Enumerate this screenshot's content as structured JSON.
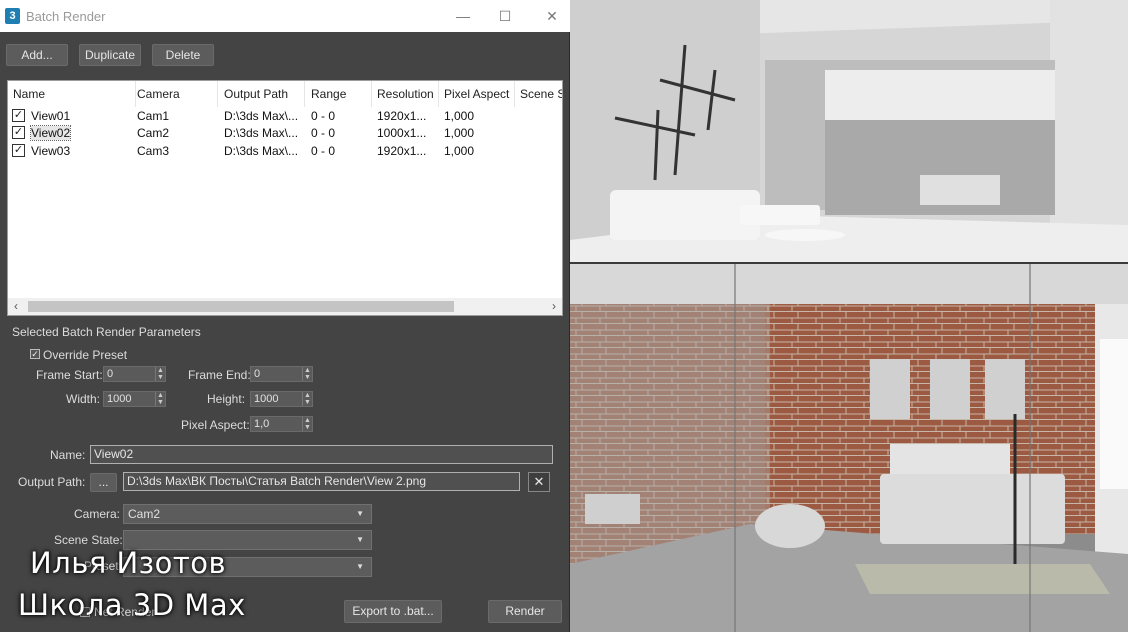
{
  "window": {
    "app_icon": "3",
    "title": "Batch Render",
    "controls": [
      "—",
      "☐",
      "✕"
    ]
  },
  "toolbar": {
    "add": "Add...",
    "duplicate": "Duplicate",
    "delete": "Delete"
  },
  "table": {
    "headers": [
      "Name",
      "Camera",
      "Output Path",
      "Range",
      "Resolution",
      "Pixel Aspect",
      "Scene St"
    ],
    "rows": [
      {
        "name": "View01",
        "camera": "Cam1",
        "output": "D:\\3ds Max\\...",
        "range": "0 - 0",
        "resolution": "1920x1...",
        "aspect": "1,000"
      },
      {
        "name": "View02",
        "camera": "Cam2",
        "output": "D:\\3ds Max\\...",
        "range": "0 - 0",
        "resolution": "1000x1...",
        "aspect": "1,000"
      },
      {
        "name": "View03",
        "camera": "Cam3",
        "output": "D:\\3ds Max\\...",
        "range": "0 - 0",
        "resolution": "1920x1...",
        "aspect": "1,000"
      }
    ]
  },
  "params": {
    "section_title": "Selected Batch Render Parameters",
    "override_preset": "Override Preset",
    "frame_start_label": "Frame Start:",
    "frame_start": "0",
    "frame_end_label": "Frame End:",
    "frame_end": "0",
    "width_label": "Width:",
    "width": "1000",
    "height_label": "Height:",
    "height": "1000",
    "pixel_aspect_label": "Pixel Aspect:",
    "pixel_aspect": "1,0",
    "name_label": "Name:",
    "name": "View02",
    "output_path_label": "Output Path:",
    "browse": "...",
    "output_path": "D:\\3ds Max\\ВК Посты\\Статья Batch Render\\View 2.png",
    "clear": "✕",
    "camera_label": "Camera:",
    "camera": "Cam2",
    "scene_state_label": "Scene State:",
    "scene_state": "",
    "preset_label": "Preset:",
    "preset": ""
  },
  "footer": {
    "net_render": "Net Render",
    "export": "Export to .bat...",
    "render": "Render"
  },
  "watermark": {
    "line1": "Илья Изотов",
    "line2": "Школа 3D Max"
  },
  "colors": {
    "dialog_bg": "#444444",
    "titlebar_bg": "#ffffff",
    "table_bg": "#ffffff",
    "brick": "#9c5a42"
  }
}
